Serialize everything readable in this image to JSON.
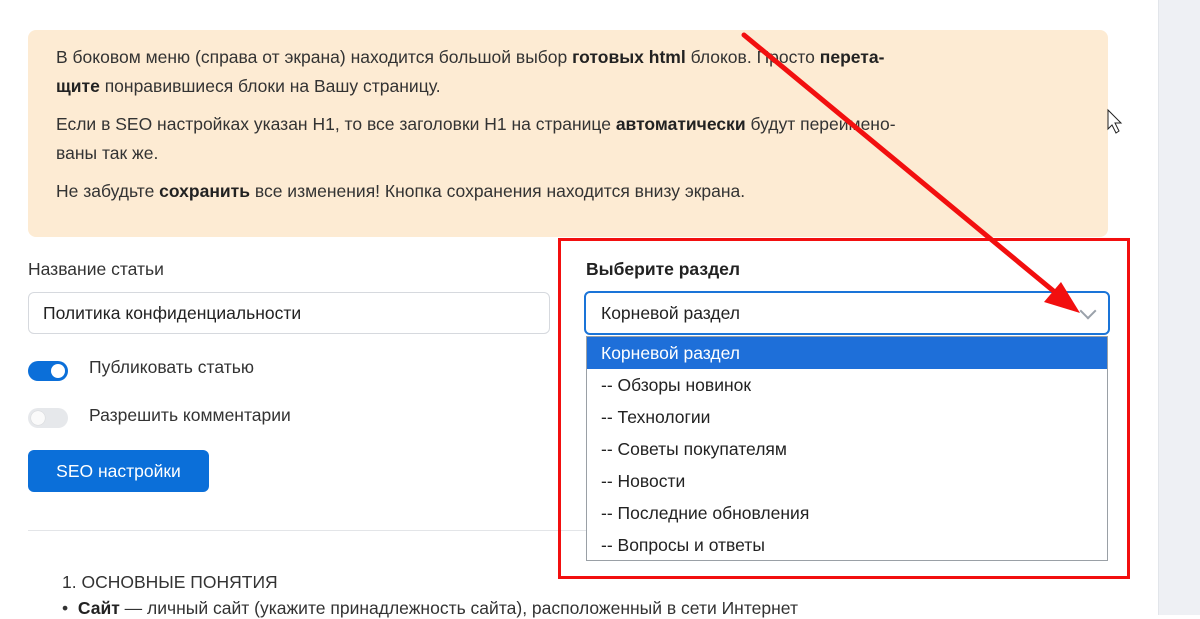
{
  "info": {
    "p1": [
      {
        "t": "В боковом меню (справа от экрана) находится большой выбор ",
        "b": false
      },
      {
        "t": "готовых html",
        "b": true
      },
      {
        "t": " блоков. Просто ",
        "b": false
      },
      {
        "t": "перета-",
        "b": true
      }
    ],
    "p1_line2": [
      {
        "t": "щите",
        "b": true
      },
      {
        "t": " понравившиеся блоки на Вашу страницу.",
        "b": false
      }
    ],
    "p2": [
      {
        "t": "Если в SEO настройках указан H1, то все заголовки H1 на странице ",
        "b": false
      },
      {
        "t": "автоматически",
        "b": true
      },
      {
        "t": " будут переимено-",
        "b": false
      }
    ],
    "p2_line2": [
      {
        "t": "ваны так же.",
        "b": false
      }
    ],
    "p3": [
      {
        "t": "Не забудьте ",
        "b": false
      },
      {
        "t": "сохранить",
        "b": true
      },
      {
        "t": " все изменения! Кнопка сохранения находится внизу экрана.",
        "b": false
      }
    ]
  },
  "article": {
    "title_label": "Название статьи",
    "title_value": "Политика конфиденциальности"
  },
  "toggles": {
    "publish": {
      "label": "Публиковать статью",
      "on": true
    },
    "comments": {
      "label": "Разрешить комментарии",
      "on": false
    }
  },
  "seo_button": "SEO настройки",
  "section": {
    "label": "Выберите раздел",
    "selected": "Корневой раздел",
    "options": [
      "Корневой раздел",
      "-- Обзоры новинок",
      "-- Технологии",
      "-- Советы покупателям",
      "-- Новости",
      "-- Последние обновления",
      "-- Вопросы и ответы"
    ]
  },
  "content": {
    "heading": "1. ОСНОВНЫЕ ПОНЯТИЯ",
    "bullet_term": "Сайт",
    "bullet_text": " — личный сайт (укажите принадлежность сайта), расположенный в сети Интернет"
  },
  "colors": {
    "accent": "#0b6fd9",
    "info_bg": "#fdebd3",
    "annotation_red": "#f20f0f"
  }
}
